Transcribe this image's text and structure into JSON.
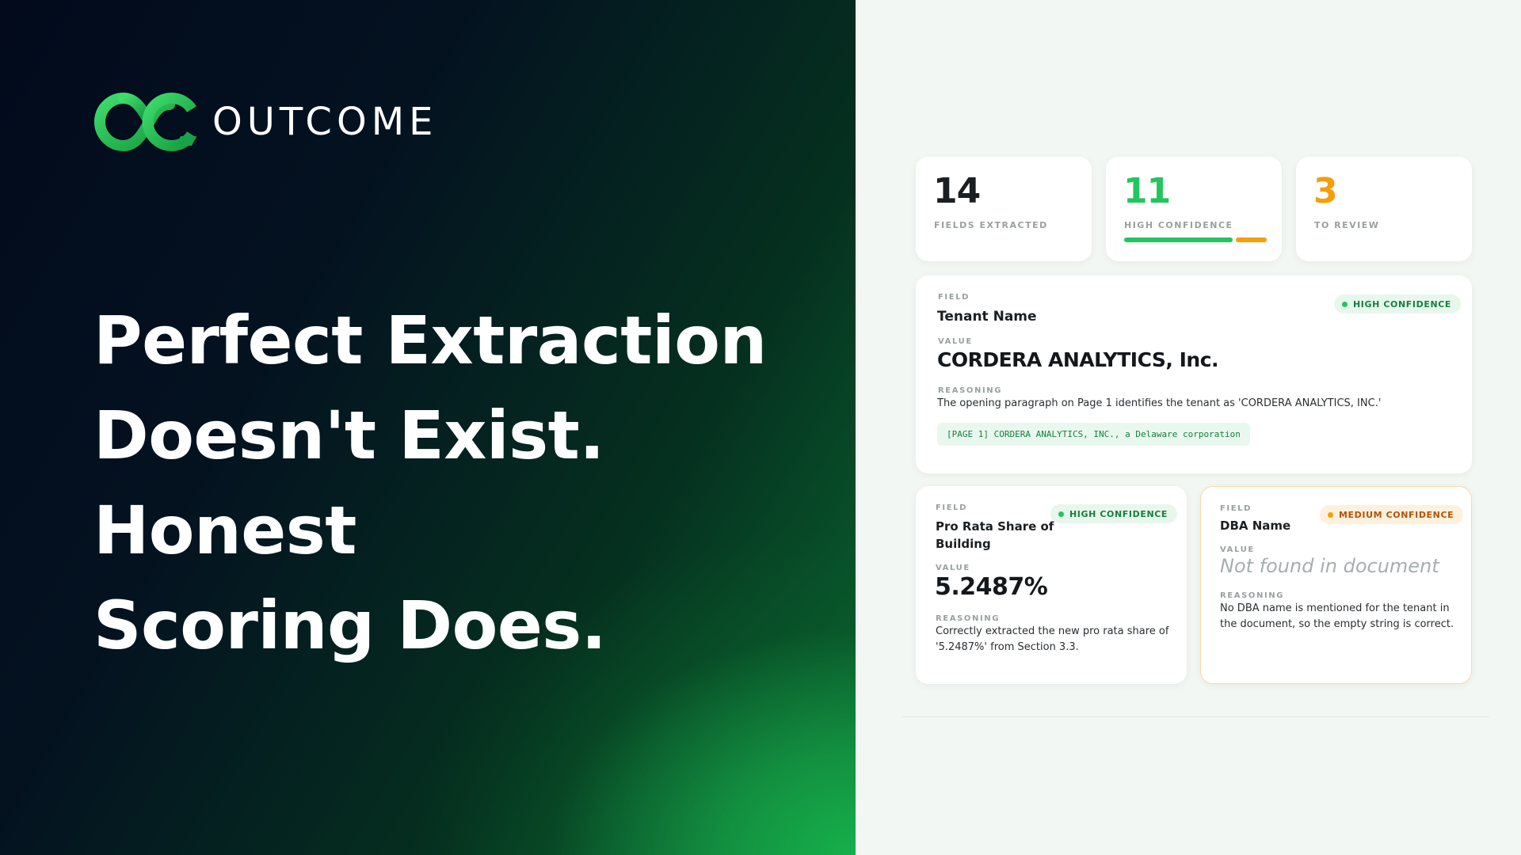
{
  "brand": {
    "name": "OUTCOME",
    "colors": {
      "green": "#22c55e",
      "orange": "#f59e0b",
      "dark": "#041220"
    }
  },
  "headline": {
    "line1": "Perfect Extraction",
    "line2": "Doesn't Exist. Honest",
    "line3": "Scoring Does."
  },
  "stats": [
    {
      "value": "14",
      "label": "FIELDS EXTRACTED",
      "color": "#1c1f22"
    },
    {
      "value": "11",
      "label": "HIGH CONFIDENCE",
      "color": "#22c55e",
      "high_fraction": 0.786,
      "review_fraction": 0.214
    },
    {
      "value": "3",
      "label": "TO REVIEW",
      "color": "#f59e0b"
    }
  ],
  "labels": {
    "field": "FIELD",
    "value": "VALUE",
    "reasoning": "REASONING"
  },
  "fields": [
    {
      "name": "Tenant Name",
      "badge": "HIGH CONFIDENCE",
      "badge_icon": "dot-icon",
      "value": "CORDERA ANALYTICS, Inc.",
      "reasoning": "The opening paragraph on Page 1 identifies the tenant as 'CORDERA ANALYTICS, INC.'",
      "citation": "[PAGE 1] CORDERA ANALYTICS, INC., a Delaware corporation"
    },
    {
      "name_line1": "Pro Rata Share of",
      "name_line2": "Building",
      "badge": "HIGH CONFIDENCE",
      "value": "5.2487%",
      "reasoning_line1": "Correctly extracted the new pro rata share of",
      "reasoning_line2": "'5.2487%' from Section 3.3."
    },
    {
      "name": "DBA Name",
      "badge": "MEDIUM CONFIDENCE",
      "value": "Not found in document",
      "reasoning_line1": "No DBA name is mentioned for the tenant in",
      "reasoning_line2": "the document, so the empty string is correct."
    }
  ]
}
